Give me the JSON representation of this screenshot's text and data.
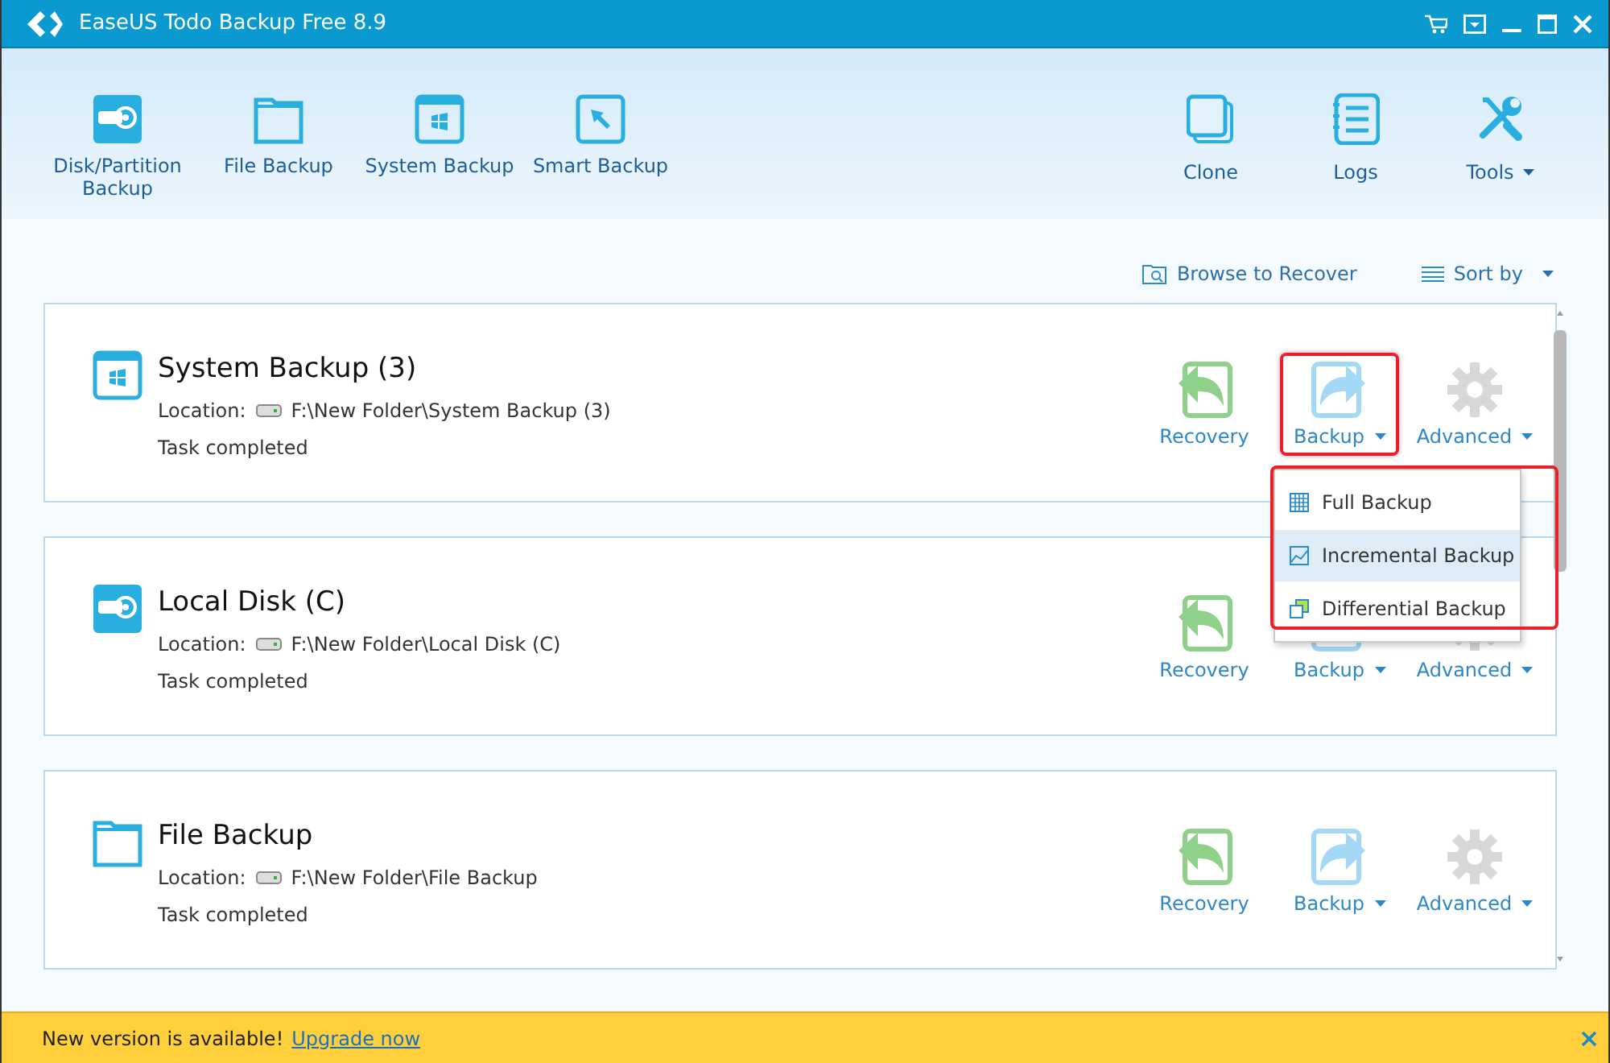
{
  "window": {
    "title": "EaseUS Todo Backup Free 8.9"
  },
  "toolbar": {
    "left": [
      {
        "label": "Disk/Partition Backup",
        "kind": "disk",
        "dropdown": false
      },
      {
        "label": "File Backup",
        "kind": "folder",
        "dropdown": false
      },
      {
        "label": "System Backup",
        "kind": "system",
        "dropdown": false
      },
      {
        "label": "Smart Backup",
        "kind": "smart",
        "dropdown": false
      }
    ],
    "right": [
      {
        "label": "Clone",
        "kind": "clone",
        "dropdown": false
      },
      {
        "label": "Logs",
        "kind": "logs",
        "dropdown": false
      },
      {
        "label": "Tools",
        "kind": "tools",
        "dropdown": true
      }
    ]
  },
  "content_bar": {
    "browse_link": "Browse to Recover",
    "sort": "Sort by"
  },
  "tasks": [
    {
      "kind": "system",
      "title": "System Backup (3)",
      "location_label": "Location:",
      "path": "F:\\New Folder\\System Backup (3)",
      "status": "Task completed",
      "actions": [
        {
          "kind": "recovery",
          "label": "Recovery",
          "dropdown": false,
          "highlighted": false
        },
        {
          "kind": "backup",
          "label": "Backup",
          "dropdown": true,
          "highlighted": true
        },
        {
          "kind": "advanced",
          "label": "Advanced",
          "dropdown": true,
          "highlighted": false
        }
      ]
    },
    {
      "kind": "disk",
      "title": "Local Disk (C)",
      "location_label": "Location:",
      "path": "F:\\New Folder\\Local Disk (C)",
      "status": "Task completed",
      "actions": [
        {
          "kind": "recovery",
          "label": "Recovery",
          "dropdown": false,
          "highlighted": false
        },
        {
          "kind": "backup",
          "label": "Backup",
          "dropdown": true,
          "highlighted": false
        },
        {
          "kind": "advanced",
          "label": "Advanced",
          "dropdown": true,
          "highlighted": false
        }
      ]
    },
    {
      "kind": "folder",
      "title": "File Backup",
      "location_label": "Location:",
      "path": "F:\\New Folder\\File Backup",
      "status": "Task completed",
      "actions": [
        {
          "kind": "recovery",
          "label": "Recovery",
          "dropdown": false,
          "highlighted": false
        },
        {
          "kind": "backup",
          "label": "Backup",
          "dropdown": true,
          "highlighted": false
        },
        {
          "kind": "advanced",
          "label": "Advanced",
          "dropdown": true,
          "highlighted": false
        }
      ]
    }
  ],
  "backup_menu": {
    "highlighted": true,
    "items": [
      {
        "kind": "full",
        "label": "Full Backup",
        "selected": false
      },
      {
        "kind": "incremental",
        "label": "Incremental Backup",
        "selected": true
      },
      {
        "kind": "differential",
        "label": "Differential Backup",
        "selected": false
      }
    ]
  },
  "notification": {
    "message": "New version is available!",
    "link": "Upgrade now"
  }
}
